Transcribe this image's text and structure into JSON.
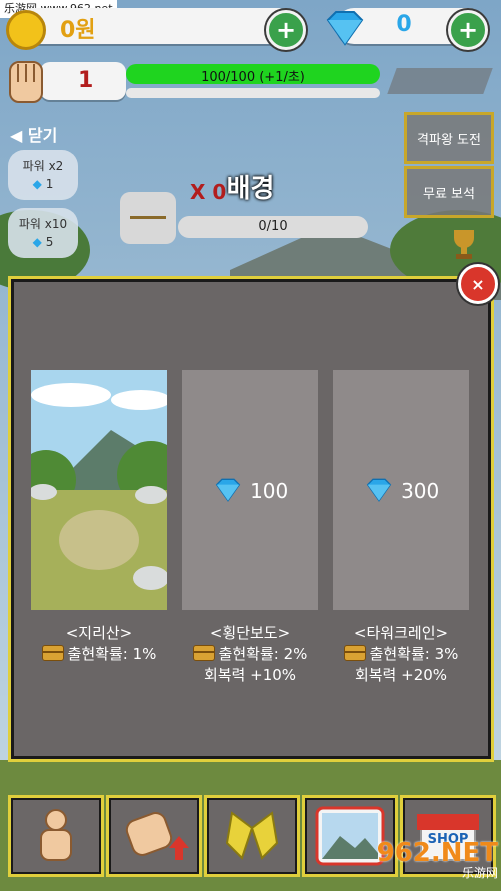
{
  "watermark": {
    "site": "乐游网 www.962.net",
    "logo": "962.NET",
    "logo_sub": "乐游网"
  },
  "top_bar": {
    "gold_amount": "0원",
    "gem_amount": "0",
    "level": "1",
    "hp_text": "100/100 (+1/초)",
    "hp_fraction": 1.0
  },
  "left_menu": {
    "close_label": "닫기",
    "power_x2_label": "파워 x2",
    "power_x2_cost": "1",
    "power_x10_label": "파워 x10",
    "power_x10_cost": "5"
  },
  "right_menu": {
    "king_challenge_label": "격파왕 도전",
    "free_gem_label": "무료 보석"
  },
  "mid": {
    "multiplier_text": "X 0",
    "progress_text": "0/10"
  },
  "dialog": {
    "title": "배경",
    "cards": [
      {
        "name": "<지리산>",
        "rate": "출현확률: 1%",
        "bonus": "",
        "price": ""
      },
      {
        "name": "<횡단보도>",
        "rate": "출현확률: 2%",
        "bonus": "회복력 +10%",
        "price": "100"
      },
      {
        "name": "<타워크레인>",
        "rate": "출현확률: 3%",
        "bonus": "회복력 +20%",
        "price": "300"
      }
    ]
  },
  "bottom_nav": [
    {
      "icon": "character-icon"
    },
    {
      "icon": "hand-upgrade-icon"
    },
    {
      "icon": "skill-icon"
    },
    {
      "icon": "background-icon"
    },
    {
      "icon": "shop-icon",
      "label": "SHOP"
    }
  ],
  "colors": {
    "accent_gold": "#e0cf3c",
    "close_red": "#d9362b",
    "gem_blue": "#2aa6e8",
    "hp_green": "#1fd41f"
  }
}
